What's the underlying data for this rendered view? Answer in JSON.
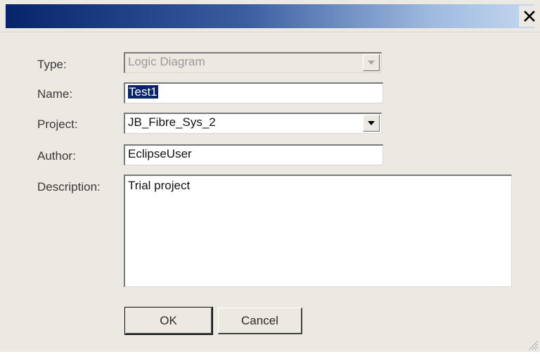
{
  "window": {
    "close_symbol": "×"
  },
  "form": {
    "type": {
      "label": "Type:",
      "value": "Logic Diagram"
    },
    "name": {
      "label": "Name:",
      "value": "Test1"
    },
    "project": {
      "label": "Project:",
      "value": "JB_Fibre_Sys_2"
    },
    "author": {
      "label": "Author:",
      "value": "EclipseUser"
    },
    "description": {
      "label": "Description:",
      "value": "Trial project"
    }
  },
  "buttons": {
    "ok": "OK",
    "cancel": "Cancel"
  },
  "icons": {
    "close": "close-icon",
    "dropdown": "chevron-down-icon",
    "resize": "resize-grip-icon"
  }
}
